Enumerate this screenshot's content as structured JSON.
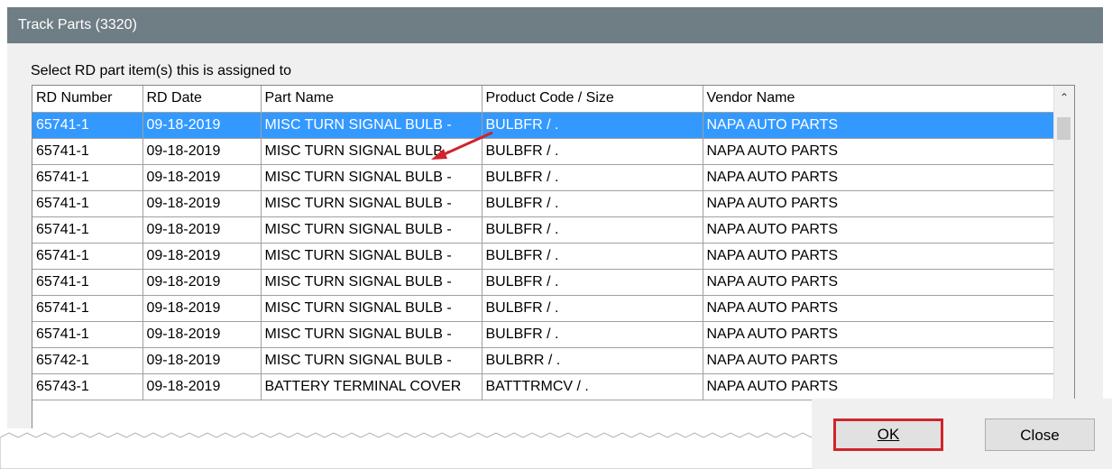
{
  "window": {
    "title": "Track Parts (3320)"
  },
  "prompt": "Select RD part item(s) this is assigned to",
  "columns": [
    "RD Number",
    "RD Date",
    "Part Name",
    "Product Code / Size",
    "Vendor Name"
  ],
  "rows": [
    [
      "65741-1",
      "09-18-2019",
      "MISC TURN SIGNAL BULB -",
      "BULBFR / .",
      "NAPA AUTO PARTS"
    ],
    [
      "65741-1",
      "09-18-2019",
      "MISC TURN SIGNAL BULB -",
      "BULBFR / .",
      "NAPA AUTO PARTS"
    ],
    [
      "65741-1",
      "09-18-2019",
      "MISC TURN SIGNAL BULB -",
      "BULBFR / .",
      "NAPA AUTO PARTS"
    ],
    [
      "65741-1",
      "09-18-2019",
      "MISC TURN SIGNAL BULB -",
      "BULBFR / .",
      "NAPA AUTO PARTS"
    ],
    [
      "65741-1",
      "09-18-2019",
      "MISC TURN SIGNAL BULB -",
      "BULBFR / .",
      "NAPA AUTO PARTS"
    ],
    [
      "65741-1",
      "09-18-2019",
      "MISC TURN SIGNAL BULB -",
      "BULBFR / .",
      "NAPA AUTO PARTS"
    ],
    [
      "65741-1",
      "09-18-2019",
      "MISC TURN SIGNAL BULB -",
      "BULBFR / .",
      "NAPA AUTO PARTS"
    ],
    [
      "65741-1",
      "09-18-2019",
      "MISC TURN SIGNAL BULB -",
      "BULBFR / .",
      "NAPA AUTO PARTS"
    ],
    [
      "65741-1",
      "09-18-2019",
      "MISC TURN SIGNAL BULB -",
      "BULBFR / .",
      "NAPA AUTO PARTS"
    ],
    [
      "65742-1",
      "09-18-2019",
      "MISC TURN SIGNAL BULB -",
      "BULBRR / .",
      "NAPA AUTO PARTS"
    ],
    [
      "65743-1",
      "09-18-2019",
      "BATTERY TERMINAL COVER",
      "BATTTRMCV / .",
      "NAPA AUTO PARTS"
    ]
  ],
  "selected_row": 0,
  "buttons": {
    "ok": "OK",
    "close": "Close"
  },
  "colors": {
    "titlebar": "#6f7d84",
    "selection": "#3399ff",
    "highlight": "#d0242b"
  },
  "icons": {
    "scroll_up": "chevron-up-icon",
    "annotation": "red-arrow-icon"
  }
}
